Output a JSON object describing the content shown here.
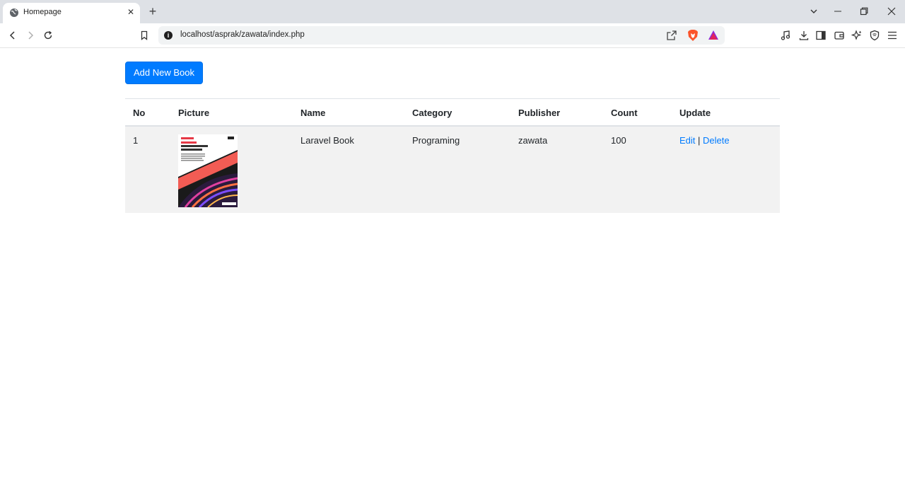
{
  "browser": {
    "tab_title": "Homepage",
    "url": "localhost/asprak/zawata/index.php"
  },
  "page": {
    "add_button_label": "Add New Book",
    "table": {
      "headers": [
        "No",
        "Picture",
        "Name",
        "Category",
        "Publisher",
        "Count",
        "Update"
      ],
      "rows": [
        {
          "no": "1",
          "picture": "laravel-book-cover",
          "name": "Laravel Book",
          "category": "Programing",
          "publisher": "zawata",
          "count": "100",
          "edit_label": "Edit",
          "separator": "|",
          "delete_label": "Delete"
        }
      ]
    }
  },
  "colors": {
    "primary": "#007bff",
    "row_stripe": "#f2f2f2",
    "border": "#dee2e6"
  }
}
